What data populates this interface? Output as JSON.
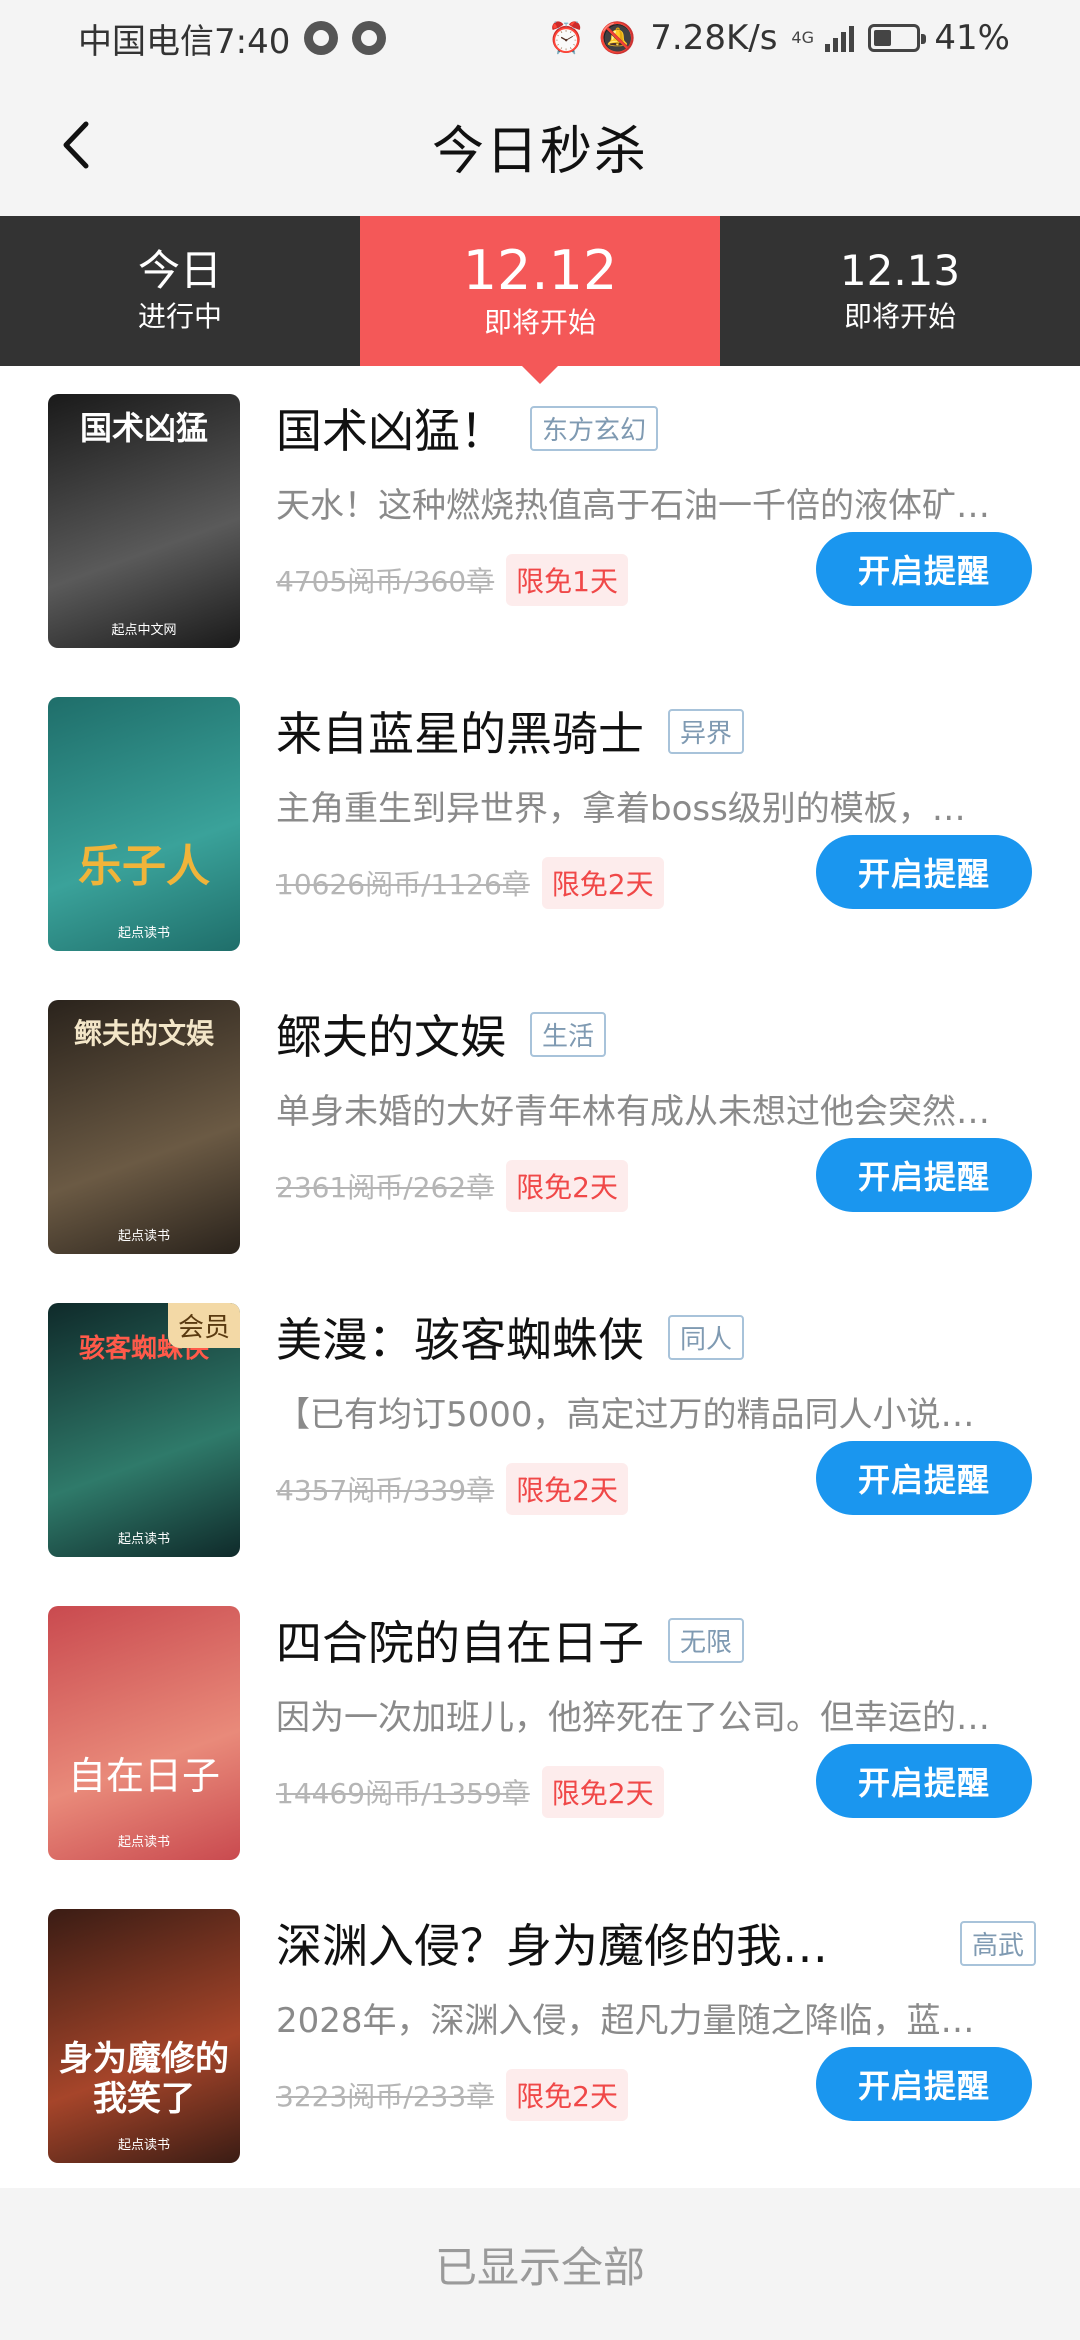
{
  "status_bar": {
    "carrier_time": "中国电信7:40",
    "net_speed": "7.28K/s",
    "net_type": "4G",
    "battery": "41%"
  },
  "header": {
    "title": "今日秒杀"
  },
  "tabs": [
    {
      "main": "今日",
      "sub": "进行中"
    },
    {
      "main": "12.12",
      "sub": "即将开始"
    },
    {
      "main": "12.13",
      "sub": "即将开始"
    }
  ],
  "books": [
    {
      "title": "国术凶猛！",
      "genre": "东方玄幻",
      "desc": "天水！这种燃烧热值高于石油一千倍的液体矿…",
      "old_price": "4705阅币/360章",
      "free": "限免1天",
      "button": "开启提醒",
      "cover_title": "国术凶猛",
      "cover_brand": "起点中文网",
      "cover_colors": [
        "#1a1a1a",
        "#5a5a5a"
      ]
    },
    {
      "title": "来自蓝星的黑骑士",
      "genre": "异界",
      "desc": "主角重生到异世界，拿着boss级别的模板，…",
      "old_price": "10626阅币/1126章",
      "free": "限免2天",
      "button": "开启提醒",
      "cover_title": "乐子人",
      "cover_brand": "起点读书",
      "cover_colors": [
        "#1f6e6a",
        "#3aa29a"
      ]
    },
    {
      "title": "鳏夫的文娱",
      "genre": "生活",
      "desc": "单身未婚的大好青年林有成从未想过他会突然…",
      "old_price": "2361阅币/262章",
      "free": "限免2天",
      "button": "开启提醒",
      "cover_title": "鳏夫的文娱",
      "cover_brand": "起点读书",
      "cover_colors": [
        "#2a231c",
        "#6b5a44"
      ]
    },
    {
      "title": "美漫：骇客蜘蛛侠",
      "genre": "同人",
      "desc": "【已有均订5000，高定过万的精品同人小说…",
      "old_price": "4357阅币/339章",
      "free": "限免2天",
      "button": "开启提醒",
      "cover_title": "骇客蜘蛛侠",
      "cover_brand": "起点读书",
      "cover_badge": "会员",
      "cover_colors": [
        "#0f2a2a",
        "#2f7a6a"
      ]
    },
    {
      "title": "四合院的自在日子",
      "genre": "无限",
      "desc": "因为一次加班儿，他猝死在了公司。但幸运的…",
      "old_price": "14469阅币/1359章",
      "free": "限免2天",
      "button": "开启提醒",
      "cover_title": "自在日子",
      "cover_brand": "起点读书",
      "cover_colors": [
        "#c94a4f",
        "#e98a7a"
      ]
    },
    {
      "title": "深渊入侵？身为魔修的我…",
      "genre": "高武",
      "desc": "2028年，深渊入侵，超凡力量随之降临，蓝…",
      "old_price": "3223阅币/233章",
      "free": "限免2天",
      "button": "开启提醒",
      "cover_title": "身为魔修的我笑了",
      "cover_brand": "起点读书",
      "cover_colors": [
        "#3a1c14",
        "#a6452a"
      ]
    }
  ],
  "footer": {
    "text": "已显示全部"
  }
}
